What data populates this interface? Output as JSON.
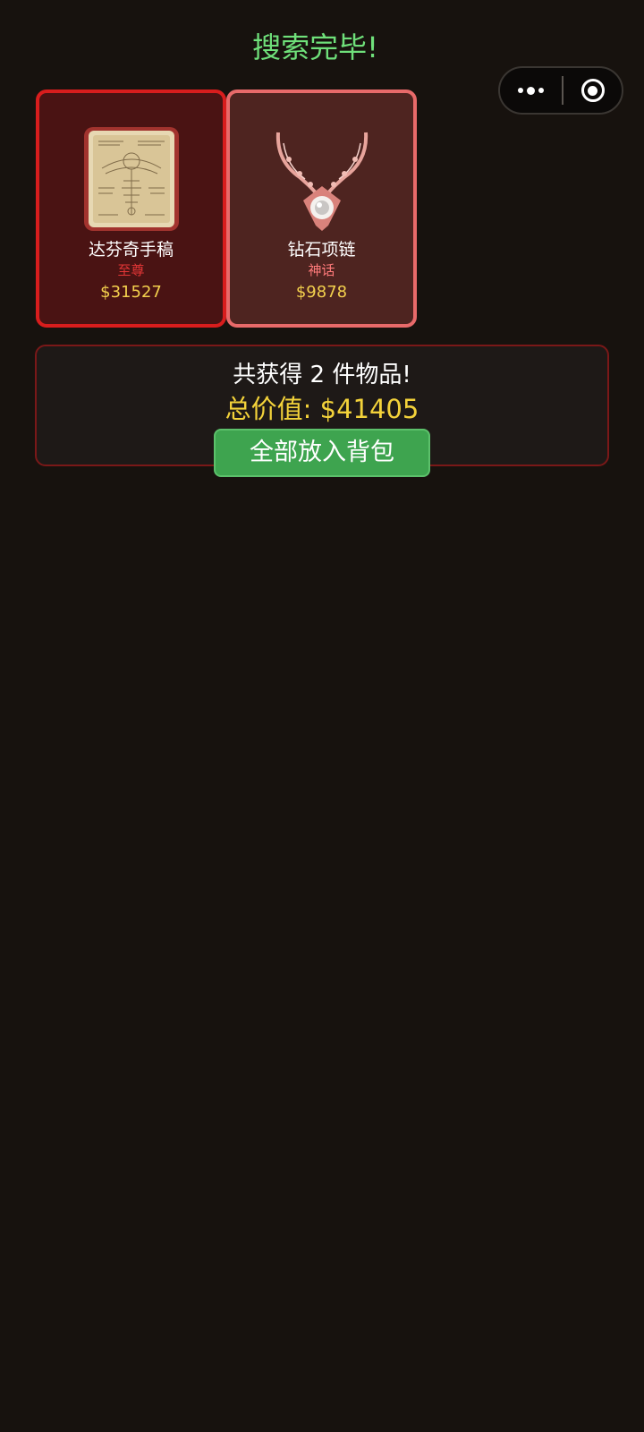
{
  "header": {
    "title": "搜索完毕!"
  },
  "capsule": {
    "more_icon": "more-dots-icon",
    "close_icon": "close-target-icon"
  },
  "items": [
    {
      "name": "达芬奇手稿",
      "rarity": "至尊",
      "price": "$31527",
      "icon": "manuscript-icon",
      "border_color": "#d81d1d"
    },
    {
      "name": "钻石项链",
      "rarity": "神话",
      "price": "$9878",
      "icon": "diamond-necklace-icon",
      "border_color": "#e86a6a"
    }
  ],
  "summary": {
    "count_text": "共获得 2 件物品!",
    "total_text": "总价值: $41405",
    "collect_button": "全部放入背包"
  },
  "colors": {
    "background": "#17120e",
    "title_green": "#6fe07a",
    "price_gold": "#f3d04d",
    "button_green": "#3ea44f"
  }
}
